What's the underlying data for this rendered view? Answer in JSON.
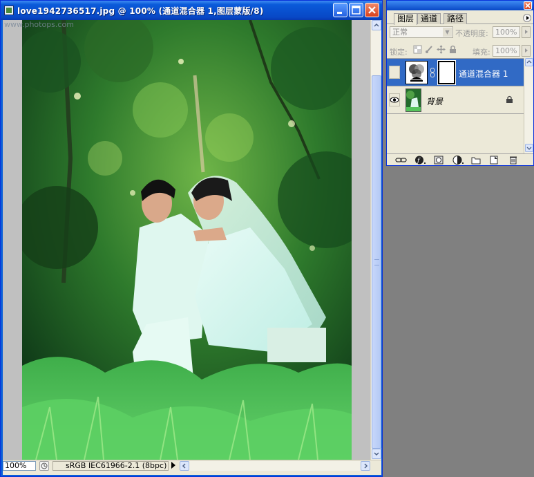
{
  "watermark": "www.photops.com",
  "document": {
    "title": "love1942736517.jpg @ 100% (通道混合器 1,图层蒙版/8)",
    "zoom": "100%",
    "status_info": "sRGB IEC61966-2.1 (8bpc)"
  },
  "layers_panel": {
    "tabs": [
      "图层",
      "通道",
      "路径"
    ],
    "active_tab": "图层",
    "blend_mode": "正常",
    "opacity_label": "不透明度:",
    "opacity_value": "100%",
    "lock_label": "锁定:",
    "fill_label": "填充:",
    "fill_value": "100%",
    "layers": [
      {
        "name": "通道混合器 1",
        "selected": true,
        "visible": false,
        "kind": "adjustment-with-mask"
      },
      {
        "name": "背景",
        "selected": false,
        "visible": true,
        "locked": true,
        "kind": "photo"
      }
    ]
  },
  "colors": {
    "titlebar": "#0a5ad9",
    "selection": "#316ac5",
    "workspace": "#808080"
  }
}
